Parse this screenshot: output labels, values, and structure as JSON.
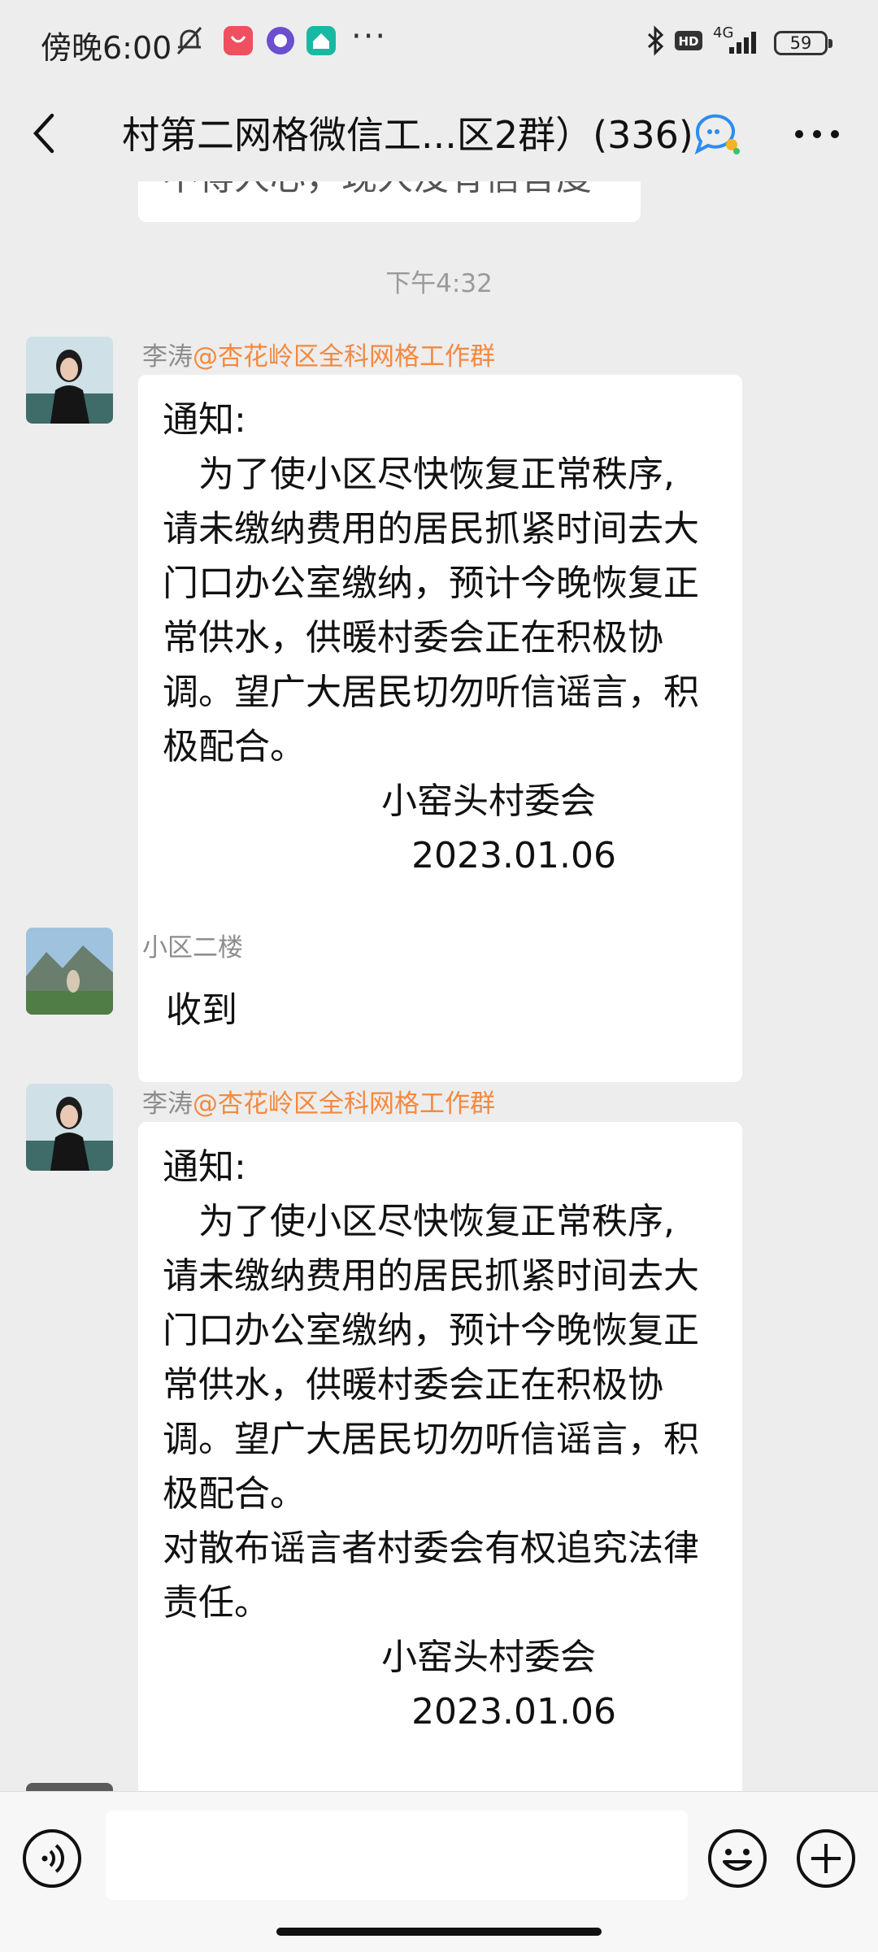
{
  "status_bar": {
    "time": "傍晚6:00",
    "network": "4G",
    "battery": "59"
  },
  "nav": {
    "title": "村第二网格微信工...区2群）(336)"
  },
  "chat": {
    "top_fragment": "不得人心，现人没有信言度",
    "time_divider": "下午4:32",
    "messages": [
      {
        "sender": "李涛",
        "mention": "@杏花岭区全科网格工作群",
        "lines": [
          "通知:",
          "　为了使小区尽快恢复正常秩序,",
          "请未缴纳费用的居民抓紧时间去大",
          "门口办公室缴纳，预计今晚恢复正",
          "常供水，供暖村委会正在积极协",
          "调。望广大居民切勿听信谣言，积",
          "极配合。"
        ],
        "signature": [
          "小窑头村委会",
          "2023.01.06"
        ]
      },
      {
        "sender": "小区二楼",
        "text": "收到"
      },
      {
        "sender": "李涛",
        "mention": "@杏花岭区全科网格工作群",
        "lines": [
          "通知:",
          "　为了使小区尽快恢复正常秩序,",
          "请未缴纳费用的居民抓紧时间去大",
          "门口办公室缴纳，预计今晚恢复正",
          "常供水，供暖村委会正在积极协",
          "调。望广大居民切勿听信谣言，积",
          "极配合。",
          "对散布谣言者村委会有权追究法律",
          "责任。"
        ],
        "signature": [
          "小窑头村委会",
          "2023.01.06"
        ]
      }
    ]
  },
  "input": {
    "placeholder": ""
  },
  "icons": {
    "back": "back-arrow-icon",
    "group_chat": "group-chat-icon",
    "more": "more-icon",
    "voice": "voice-input-icon",
    "emoji": "emoji-icon",
    "add": "plus-icon"
  },
  "colors": {
    "background": "#ededed",
    "bubble": "#ffffff",
    "mention": "#f3893f",
    "meta_text": "#9a9a9a"
  }
}
